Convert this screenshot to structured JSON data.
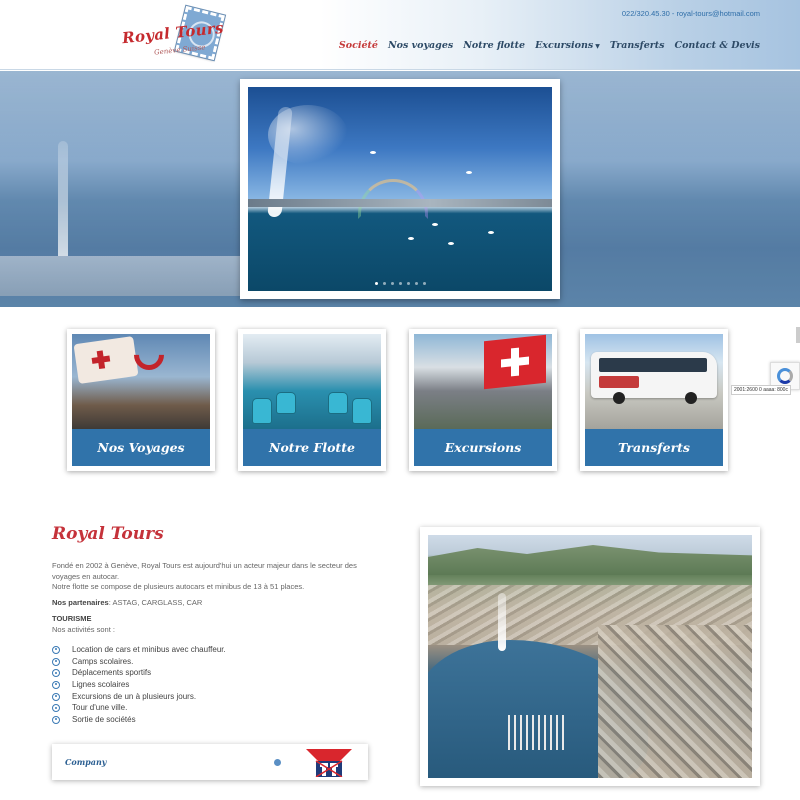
{
  "header": {
    "logo_text": "Royal Tours",
    "logo_subtext": "Genève Suisse",
    "contact": "022/320.45.30 - royal-tours@hotmail.com",
    "nav": [
      {
        "label": "Société",
        "active": true,
        "has_dropdown": false
      },
      {
        "label": "Nos voyages",
        "active": false,
        "has_dropdown": false
      },
      {
        "label": "Notre flotte",
        "active": false,
        "has_dropdown": false
      },
      {
        "label": "Excursions",
        "active": false,
        "has_dropdown": true
      },
      {
        "label": "Transferts",
        "active": false,
        "has_dropdown": false
      },
      {
        "label": "Contact & Devis",
        "active": false,
        "has_dropdown": false
      }
    ]
  },
  "slider": {
    "slide_count": 7,
    "active_slide": 1
  },
  "cards": [
    {
      "label": "Nos Voyages"
    },
    {
      "label": "Notre Flotte"
    },
    {
      "label": "Excursions"
    },
    {
      "label": "Transferts"
    }
  ],
  "about": {
    "title": "Royal Tours",
    "intro_1": "Fondé en 2002 à Genève, Royal Tours est aujourd'hui un acteur majeur dans le secteur des voyages en autocar.",
    "intro_2": "Notre flotte se compose de plusieurs autocars et minibus de 13 à 51 places.",
    "partners_label": "Nos partenaires",
    "partners_value": ": ASTAG, CARGLASS, CAR",
    "tourisme_label": "TOURISME",
    "activities_label": "Nos activités sont :",
    "activities": [
      "Location de cars et minibus avec chauffeur.",
      "Camps scolaires.",
      "Déplacements sportifs",
      "Lignes scolaires",
      "Excursions de un à plusieurs jours.",
      "Tour d'une ville.",
      "Sortie de sociétés"
    ]
  },
  "company_box": {
    "label": "Company"
  },
  "overlay": {
    "coords_text": "2001:2600 0 aaaa: 800c"
  },
  "colors": {
    "accent_red": "#c5323a",
    "card_blue": "#3073aa",
    "nav_text": "#2d4a66"
  }
}
